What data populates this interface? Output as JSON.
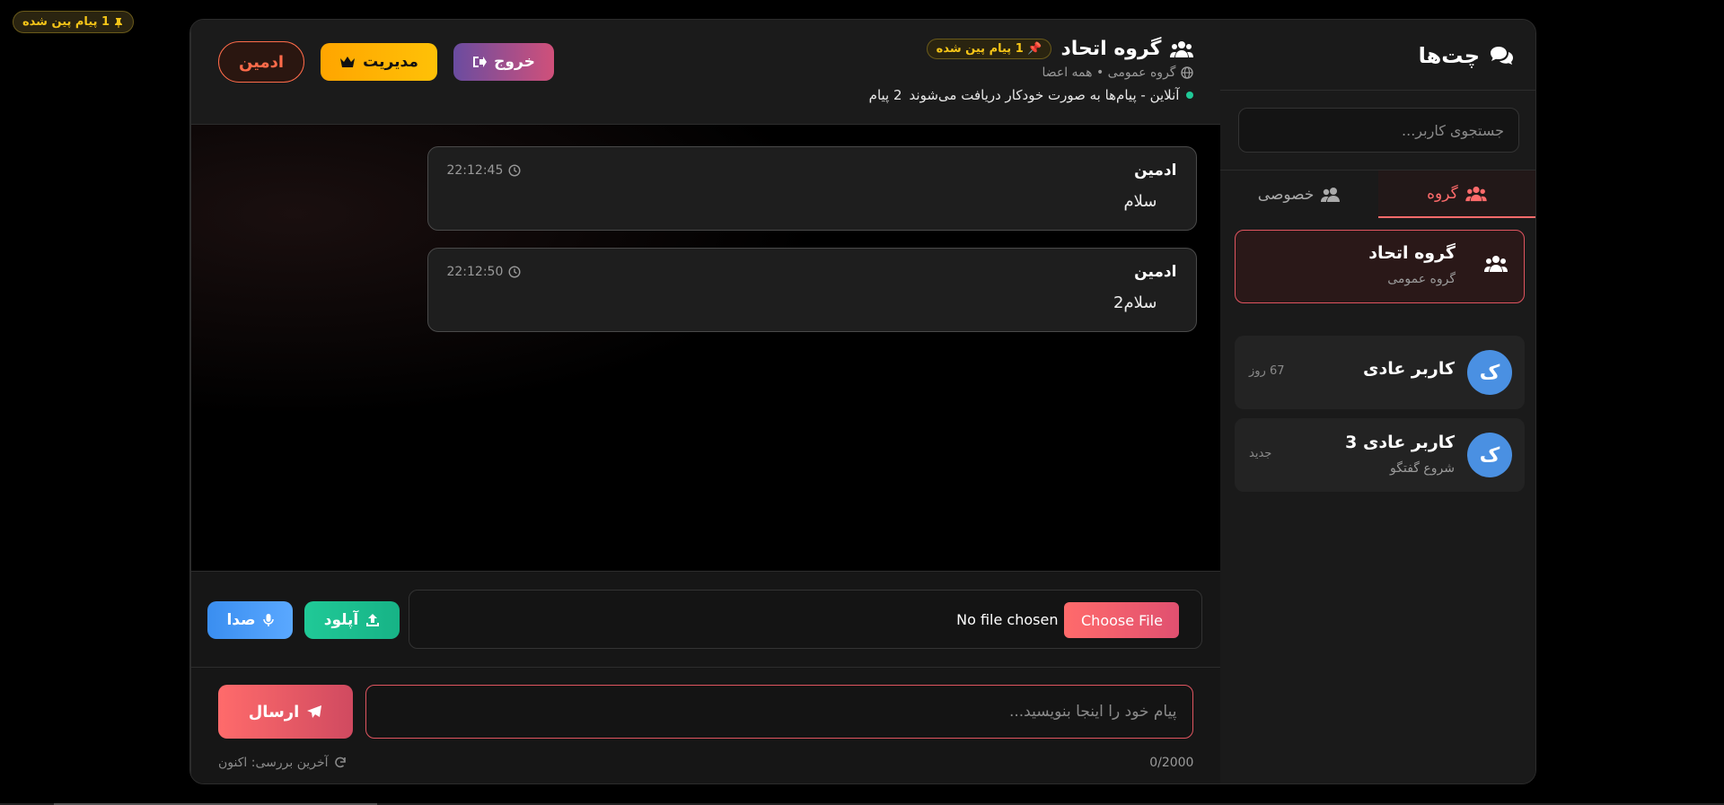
{
  "floating_pin": {
    "label": "1 پیام پین شده"
  },
  "header": {
    "title": "گروه اتحاد",
    "pin_badge": "1 پیام پین شده",
    "subtitle": "گروه عمومی • همه اعضا",
    "status": "آنلاین - پیام‌ها به صورت خودکار دریافت می‌شوند",
    "message_count": "2 پیام",
    "buttons": {
      "admin": "ادمین",
      "manage": "مدیریت",
      "exit": "خروج"
    }
  },
  "messages": [
    {
      "sender": "ادمین",
      "text": "سلام",
      "time": "22:12:45"
    },
    {
      "sender": "ادمین",
      "text": "سلام2",
      "time": "22:12:50"
    }
  ],
  "upload": {
    "choose_file": "Choose File",
    "no_file": "No file chosen",
    "upload_label": "آپلود",
    "voice_label": "صدا"
  },
  "compose": {
    "placeholder": "پیام خود را اینجا بنویسید...",
    "send_label": "ارسال",
    "char_count": "0/2000",
    "last_check": "آخرین بررسی: اکنون"
  },
  "sidebar": {
    "title": "چت‌ها",
    "search_placeholder": "جستجوی کاربر...",
    "tabs": [
      {
        "label": "گروه",
        "active": true
      },
      {
        "label": "خصوصی",
        "active": false
      }
    ],
    "group": {
      "name": "گروه اتحاد",
      "sub": "گروه عمومی"
    },
    "users": [
      {
        "initial": "ک",
        "name": "کاربر عادی",
        "sub": "",
        "meta": "67 روز"
      },
      {
        "initial": "ک",
        "name": "کاربر عادی 3",
        "sub": "شروع گفتگو",
        "meta": "جدید"
      }
    ]
  },
  "colors": {
    "accent": "#ff6b6b",
    "gold": "#f5c518",
    "online": "#20c997",
    "avatar": "#4a90e2"
  }
}
